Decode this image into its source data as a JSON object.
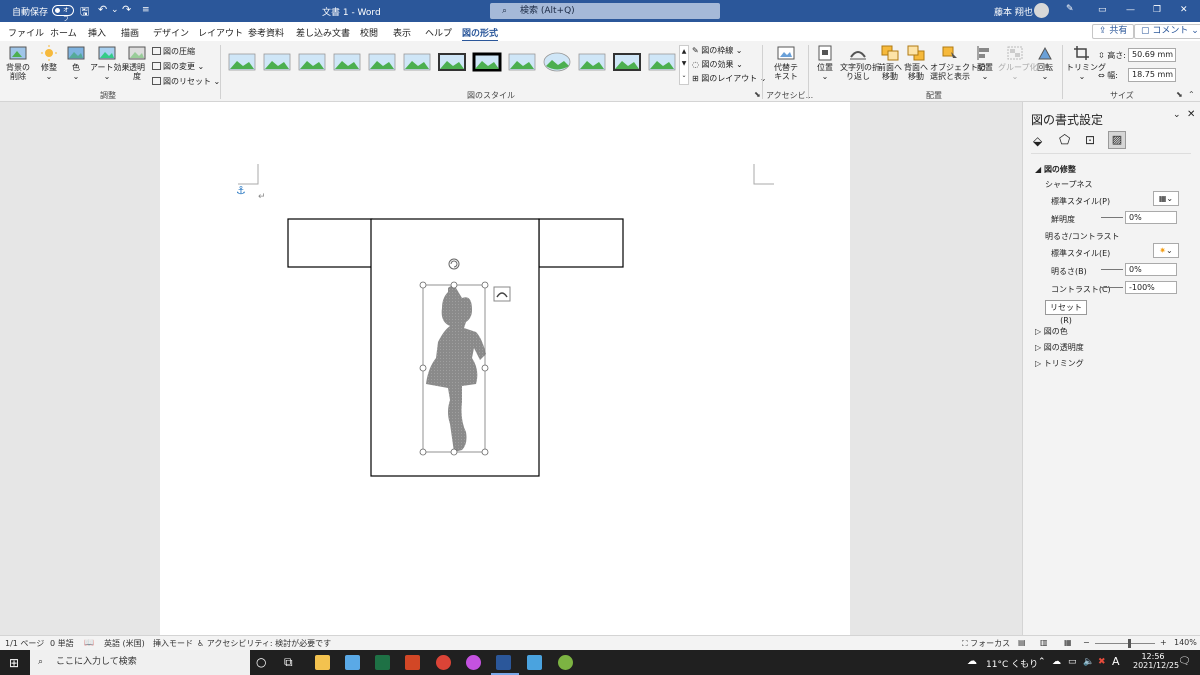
{
  "titlebar": {
    "autosave_label": "自動保存",
    "autosave_state": "オフ",
    "doc_title": "文書 1 - Word",
    "search_placeholder": "検索 (Alt+Q)",
    "user_name": "藤本 翔也",
    "bg_color": "#2b579a"
  },
  "menu": {
    "tabs": [
      "ファイル",
      "ホーム",
      "挿入",
      "描画",
      "デザイン",
      "レイアウト",
      "参考資料",
      "差し込み文書",
      "校閲",
      "表示",
      "ヘルプ",
      "図の形式"
    ],
    "share": "共有",
    "comment": "コメント"
  },
  "ribbon": {
    "remove_bg": "背景の\n削除",
    "corrections": "修整",
    "color": "色",
    "artistic": "アート効果",
    "transparency": "透明\n度",
    "compress": "図の圧縮",
    "change": "図の変更",
    "reset": "図のリセット",
    "group_adjust": "調整",
    "group_styles": "図のスタイル",
    "border": "図の枠線",
    "effects": "図の効果",
    "layout": "図のレイアウト",
    "alt_text": "代替テ\nキスト",
    "group_access": "アクセシビ...",
    "position": "位置",
    "wrap": "文字列の折\nり返し",
    "bring_forward": "前面へ\n移動",
    "send_backward": "背面へ\n移動",
    "selection_pane": "オブジェクトの\n選択と表示",
    "align": "配置",
    "group": "グループ化",
    "rotate": "回転",
    "group_arrange": "配置",
    "crop": "トリミング",
    "height_label": "高さ:",
    "height_value": "50.69 mm",
    "width_label": "幅:",
    "width_value": "18.75 mm",
    "group_size": "サイズ"
  },
  "pane": {
    "title": "図の書式設定",
    "section_correct": "図の修整",
    "sharpness": "シャープネス",
    "preset1": "標準スタイル(P)",
    "sharpen": "鮮明度",
    "sharpen_value": "0%",
    "bright_contrast": "明るさ/コントラスト",
    "preset2": "標準スタイル(E)",
    "brightness": "明るさ(B)",
    "brightness_value": "0%",
    "contrast": "コントラスト(C)",
    "contrast_value": "-100%",
    "reset_button": "リセット(R)",
    "section_color": "図の色",
    "section_transparency": "図の透明度",
    "section_crop": "トリミング"
  },
  "status": {
    "page": "1/1 ページ",
    "words": "0 単語",
    "language": "英語 (米国)",
    "mode": "挿入モード",
    "accessibility": "アクセシビリティ: 検討が必要です",
    "focus": "フォーカス",
    "zoom": "140%"
  },
  "taskbar": {
    "search_placeholder": "ここに入力して検索",
    "weather": "11°C くもり",
    "ime": "A",
    "time": "12:56",
    "date": "2021/12/25"
  }
}
